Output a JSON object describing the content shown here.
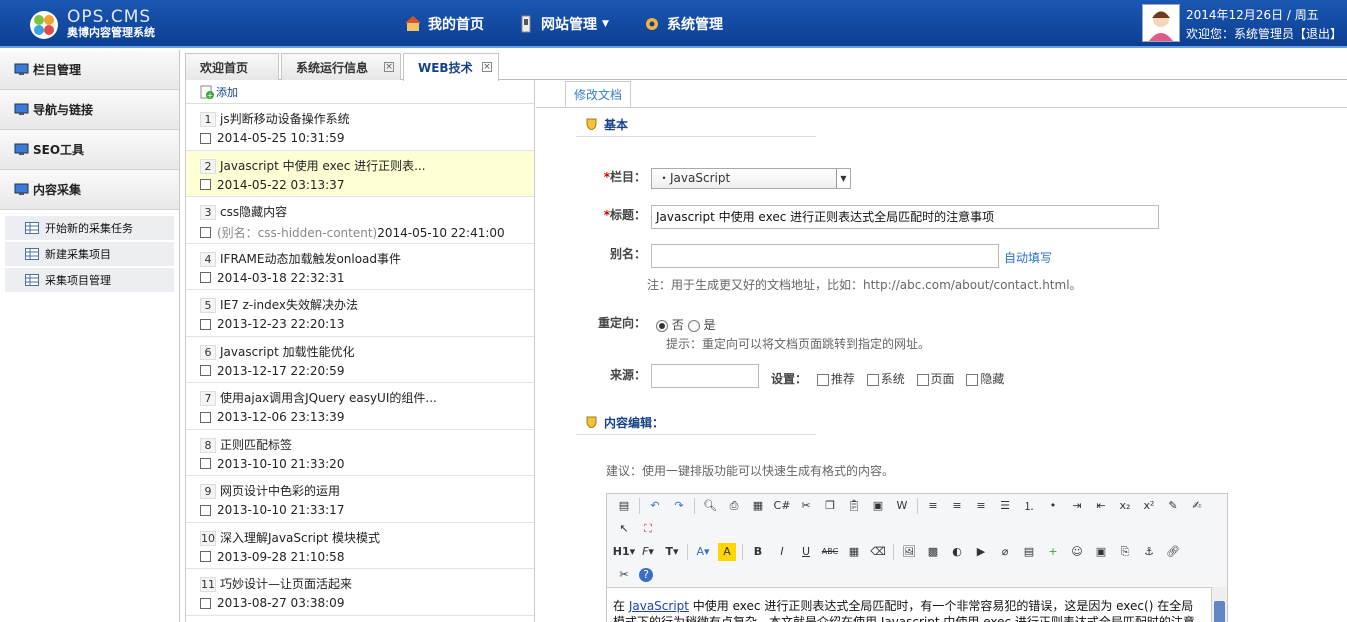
{
  "header": {
    "brand_main": "OPS.CMS",
    "brand_sub": "奥博内容管理系统",
    "nav": [
      {
        "label": "我的首页"
      },
      {
        "label": "网站管理"
      },
      {
        "label": "系统管理"
      }
    ],
    "date": "2014年12月26日 / 周五",
    "welcome": "欢迎您：系统管理员【退出】"
  },
  "sidebar": {
    "items": [
      {
        "label": "栏目管理"
      },
      {
        "label": "导航与链接"
      },
      {
        "label": "SEO工具"
      },
      {
        "label": "内容采集"
      }
    ],
    "sub_items": [
      {
        "label": "开始新的采集任务"
      },
      {
        "label": "新建采集项目"
      },
      {
        "label": "采集项目管理"
      }
    ]
  },
  "tabs": [
    {
      "label": "欢迎首页"
    },
    {
      "label": "系统运行信息"
    },
    {
      "label": "WEB技术"
    }
  ],
  "list": {
    "add_label": "添加",
    "rows": [
      {
        "num": "1",
        "title": "js判断移动设备操作系统",
        "alias": "",
        "date": "2014-05-25 10:31:59"
      },
      {
        "num": "2",
        "title": "Javascript 中使用 exec 进行正则表...",
        "alias": "",
        "date": "2014-05-22 03:13:37"
      },
      {
        "num": "3",
        "title": "css隐藏内容",
        "alias": "(别名：css-hidden-content)",
        "date": "2014-05-10 22:41:00"
      },
      {
        "num": "4",
        "title": "IFRAME动态加载触发onload事件",
        "alias": "",
        "date": "2014-03-18 22:32:31"
      },
      {
        "num": "5",
        "title": "IE7 z-index失效解决办法",
        "alias": "",
        "date": "2013-12-23 22:20:13"
      },
      {
        "num": "6",
        "title": "Javascript 加载性能优化",
        "alias": "",
        "date": "2013-12-17 22:20:59"
      },
      {
        "num": "7",
        "title": "使用ajax调用含JQuery easyUI的组件...",
        "alias": "",
        "date": "2013-12-06 23:13:39"
      },
      {
        "num": "8",
        "title": "正则匹配标签",
        "alias": "",
        "date": "2013-10-10 21:33:20"
      },
      {
        "num": "9",
        "title": "网页设计中色彩的运用",
        "alias": "",
        "date": "2013-10-10 21:33:17"
      },
      {
        "num": "10",
        "title": "深入理解JavaScript 模块模式",
        "alias": "",
        "date": "2013-09-28 21:10:58"
      },
      {
        "num": "11",
        "title": "巧妙设计—让页面活起来",
        "alias": "",
        "date": "2013-08-27 03:38:09"
      }
    ]
  },
  "editor_form": {
    "tab_label": "修改文档",
    "section_basic": "基本",
    "column_label": "栏目：",
    "column_value": "・JavaScript",
    "title_label": "标题：",
    "title_value": "Javascript 中使用 exec 进行正则表达式全局匹配时的注意事项",
    "alias_label": "别名：",
    "alias_value": "",
    "auto_fill": "自动填写",
    "alias_note": "注：用于生成更又好的文档地址，比如：http://abc.com/about/contact.html。",
    "redirect_label": "重定向：",
    "redirect_no": "否",
    "redirect_yes": "是",
    "redirect_hint": "提示：重定向可以将文档页面跳转到指定的网址。",
    "source_label": "来源：",
    "source_value": "",
    "settings_label": "设置：",
    "settings_opts": [
      "推荐",
      "系统",
      "页面",
      "隐藏"
    ],
    "section_content": "内容编辑：",
    "suggest": "建议：使用一键排版功能可以快速生成有格式的内容。",
    "content_link": "JavaScript",
    "content_pre": "在 ",
    "content_text": " 中使用 exec 进行正则表达式全局匹配时，有一个非常容易犯的错误，这是因为 exec() 在全局模式下的行为稍微有点复杂，本文就是介绍在使用 Javascript 中使用 exec 进行正则表达式全局匹配时的注意事项。",
    "toolbar_h1": "H1",
    "toolbar_font": "F",
    "toolbar_size": "T",
    "toolbar_bold": "B",
    "toolbar_italic": "I",
    "toolbar_underline": "U",
    "toolbar_strike": "ABC"
  },
  "colors": {
    "header_bg": "#1b57b3",
    "highlight_row": "#ffffd6",
    "accent": "#15428b"
  }
}
